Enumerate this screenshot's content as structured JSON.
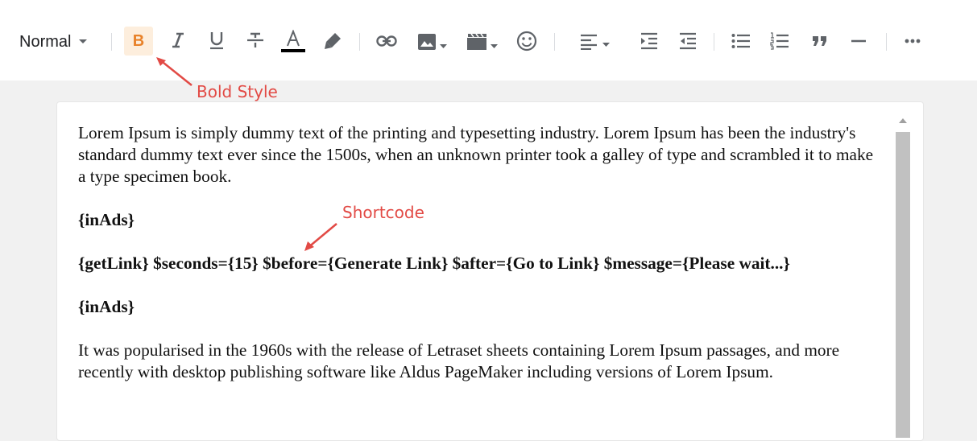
{
  "toolbar": {
    "format_label": "Normal",
    "buttons": {
      "bold": "B",
      "italic": "I",
      "underline": "U",
      "strikethrough": "S",
      "text_color": "A"
    },
    "icons": [
      "bold-icon",
      "italic-icon",
      "underline-icon",
      "strikethrough-icon",
      "text-color-icon",
      "highlight-icon",
      "link-icon",
      "image-icon",
      "video-icon",
      "emoji-icon",
      "align-icon",
      "indent-icon",
      "outdent-icon",
      "bulleted-list-icon",
      "numbered-list-icon",
      "quote-icon",
      "horizontal-rule-icon",
      "more-icon"
    ],
    "text_color_bar": "#000000",
    "active_bg": "#fdeedd",
    "active_color": "#e8822a"
  },
  "annotations": {
    "bold": "Bold Style",
    "shortcode": "Shortcode",
    "color": "#e24a45"
  },
  "editor": {
    "para1": "Lorem Ipsum is simply dummy text of the printing and typesetting industry. Lorem Ipsum has been the industry's standard dummy text ever since the 1500s, when an unknown printer took a galley of type and scrambled it to make a type specimen book.",
    "inads1": "{inAds}",
    "getlink": "{getLink} $seconds={15} $before={Generate Link} $after={Go to Link} $message={Please wait...}",
    "inads2": "{inAds}",
    "para2": "It was popularised in the 1960s with the release of Letraset sheets containing Lorem Ipsum passages, and more recently with desktop publishing software like Aldus PageMaker including versions of Lorem Ipsum."
  }
}
